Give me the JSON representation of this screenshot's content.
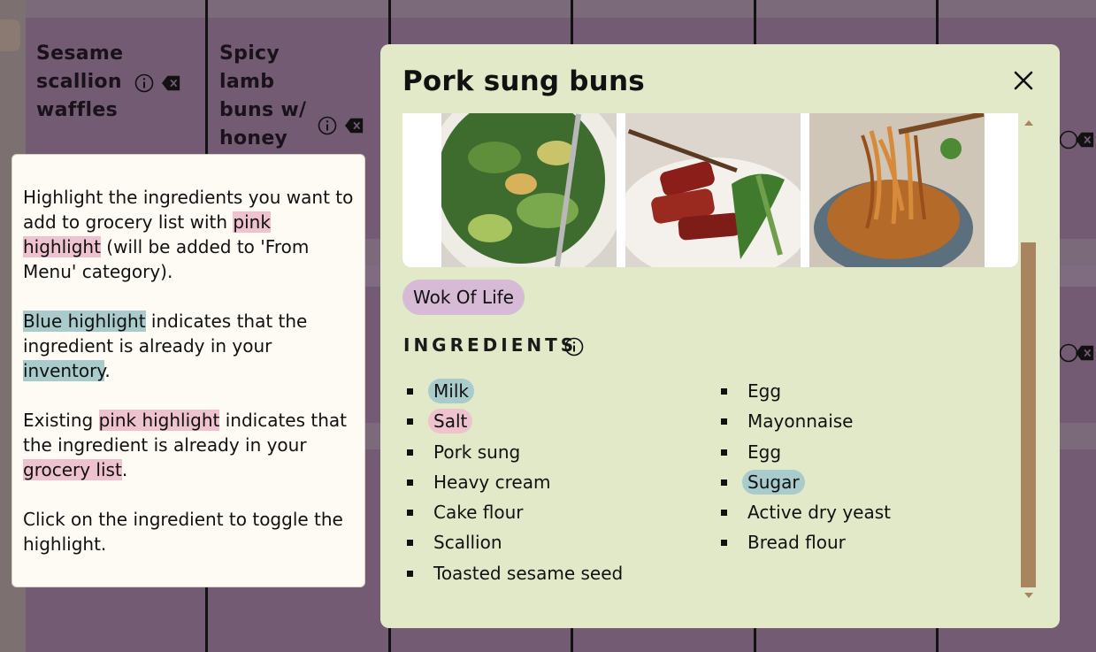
{
  "background": {
    "recipes": [
      {
        "lines": [
          "Sesame",
          "scallion",
          "waffles"
        ]
      },
      {
        "lines": [
          "Spicy",
          "lamb",
          "buns w/",
          "honey"
        ]
      }
    ],
    "icons": [
      "info-icon",
      "delete-icon"
    ]
  },
  "help": {
    "p1_a": "Highlight the ingredients you want to add to grocery list with ",
    "p1_hl": "pink highlight",
    "p1_b": " (will be added to 'From Menu' category).",
    "p2_hl": "Blue highlight",
    "p2_a": " indicates that the ingredient is already in your ",
    "p2_hl2": "inventory",
    "p2_b": ".",
    "p3_a": "Existing ",
    "p3_hl": "pink highlight",
    "p3_b": " indicates that the ingredient is already in your ",
    "p3_hl2": "grocery list",
    "p3_c": ".",
    "p4": "Click on the ingredient to toggle the highlight."
  },
  "modal": {
    "title": "Pork sung buns",
    "close_icon": "close-icon",
    "images": [
      "cucumber-salad-image",
      "char-siu-pork-image",
      "noodles-image"
    ],
    "source": "Wok Of Life",
    "ingredients_heading": "INGREDIENTS",
    "ingredients_left": [
      {
        "name": "Milk",
        "highlight": "blue"
      },
      {
        "name": "Salt",
        "highlight": "pink"
      },
      {
        "name": "Pork sung",
        "highlight": "none"
      },
      {
        "name": "Heavy cream",
        "highlight": "none"
      },
      {
        "name": "Cake flour",
        "highlight": "none"
      },
      {
        "name": "Scallion",
        "highlight": "none"
      },
      {
        "name": "Toasted sesame seed",
        "highlight": "none"
      }
    ],
    "ingredients_right": [
      {
        "name": "Egg",
        "highlight": "none"
      },
      {
        "name": "Mayonnaise",
        "highlight": "none"
      },
      {
        "name": "Egg",
        "highlight": "none"
      },
      {
        "name": "Sugar",
        "highlight": "blue"
      },
      {
        "name": "Active dry yeast",
        "highlight": "none"
      },
      {
        "name": "Bread flour",
        "highlight": "none"
      }
    ]
  },
  "colors": {
    "modal_bg": "#e2e9c9",
    "pink_highlight": "#eec2ce",
    "blue_highlight": "#a9cbcb",
    "tag_bg": "#d7bad6",
    "scrollbar": "#a8845f"
  }
}
